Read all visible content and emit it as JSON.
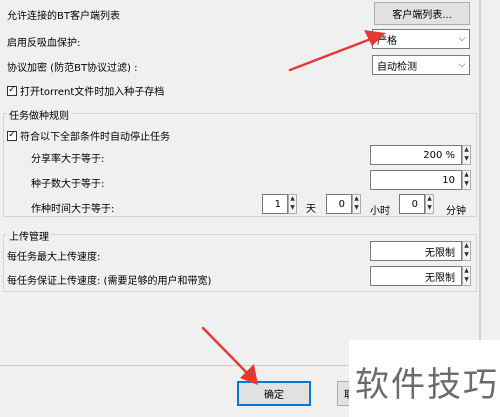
{
  "connection": {
    "allowed_clients_label": "允许连接的BT客户端列表",
    "client_list_button": "客户端列表...",
    "anti_leech_label": "启用反吸血保护:",
    "anti_leech_value": "严格",
    "encryption_label": "协议加密 (防范BT协议过滤) :",
    "encryption_value": "自动检测",
    "add_torrent_label": "打开torrent文件时加入种子存档",
    "add_torrent_checked": true
  },
  "seeding": {
    "title": "任务做种规则",
    "auto_stop_label": "符合以下全部条件时自动停止任务",
    "auto_stop_checked": true,
    "share_ratio_label": "分享率大于等于:",
    "share_ratio_value": "200 %",
    "seeds_label": "种子数大于等于:",
    "seeds_value": "10",
    "seed_time_label": "作种时间大于等于:",
    "days_value": "1",
    "days_unit": "天",
    "hours_value": "0",
    "hours_unit": "小时",
    "minutes_value": "0",
    "minutes_unit": "分钟"
  },
  "upload": {
    "title": "上传管理",
    "max_speed_label": "每任务最大上传速度:",
    "max_speed_value": "无限制",
    "guaranteed_speed_label": "每任务保证上传速度: (需要足够的用户和带宽)",
    "guaranteed_speed_value": "无限制"
  },
  "footer": {
    "ok_button": "确定",
    "cancel_button_partial": "取"
  },
  "watermark": "软件技巧",
  "colors": {
    "arrow": "#e53935",
    "focus": "#0078d7"
  }
}
